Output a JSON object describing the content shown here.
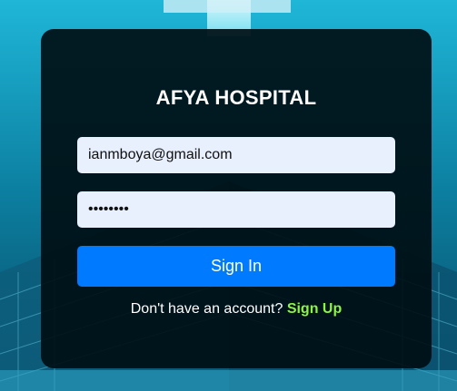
{
  "app": {
    "title": "AFYA HOSPITAL"
  },
  "form": {
    "email_value": "ianmboya@gmail.com",
    "password_value": "passw0rd",
    "signin_label": "Sign In",
    "footer_text": "Don't have an account?",
    "signup_label": "Sign Up"
  },
  "colors": {
    "primary_button": "#007bff",
    "signup_link": "#8cf542",
    "card_background": "#000e14",
    "input_background": "#e8f0fe"
  }
}
